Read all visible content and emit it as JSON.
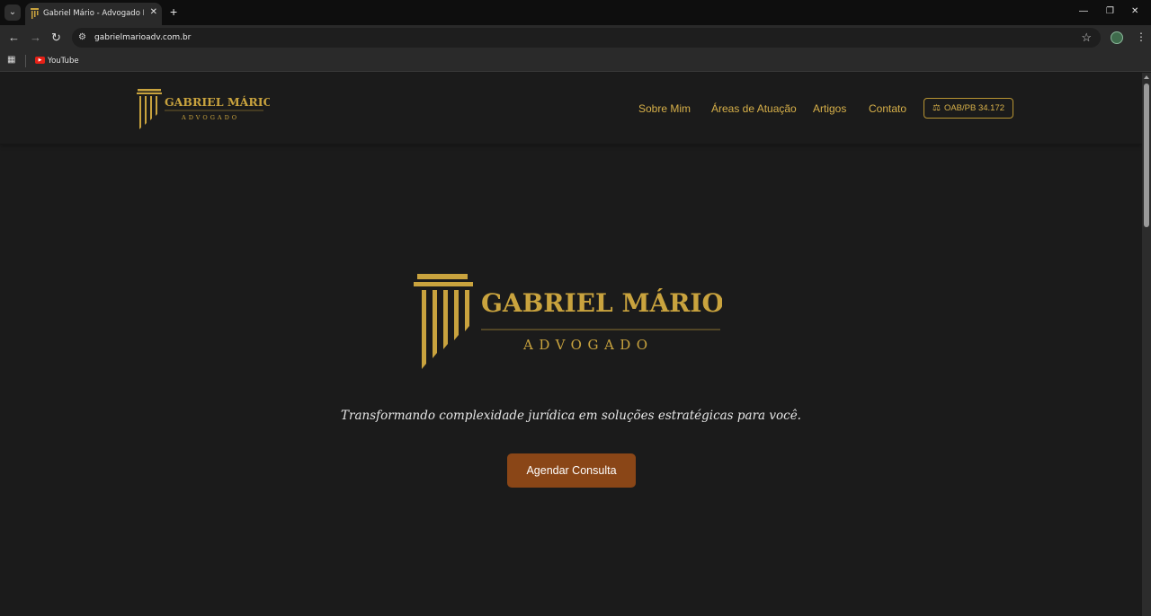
{
  "browser": {
    "tab_title": "Gabriel Mário - Advogado Espe",
    "url": "gabrielmarioadv.com.br",
    "bookmarks": [
      {
        "label": "YouTube"
      }
    ]
  },
  "header": {
    "logo_name": "GABRIEL MÁRIO",
    "logo_subtitle": "ADVOGADO",
    "nav": [
      {
        "label": "Sobre Mim"
      },
      {
        "label": "Áreas de Atuação"
      },
      {
        "label": "Artigos"
      },
      {
        "label": "Contato"
      }
    ],
    "badge": "OAB/PB 34.172",
    "badge_icon": "scale-icon"
  },
  "hero": {
    "logo_name": "GABRIEL MÁRIO",
    "logo_subtitle": "ADVOGADO",
    "tagline": "Transformando complexidade jurídica em soluções estratégicas para você.",
    "cta": "Agendar Consulta"
  },
  "colors": {
    "gold": "#d7b049",
    "background": "#1b1b1b",
    "cta": "#8a4617"
  }
}
